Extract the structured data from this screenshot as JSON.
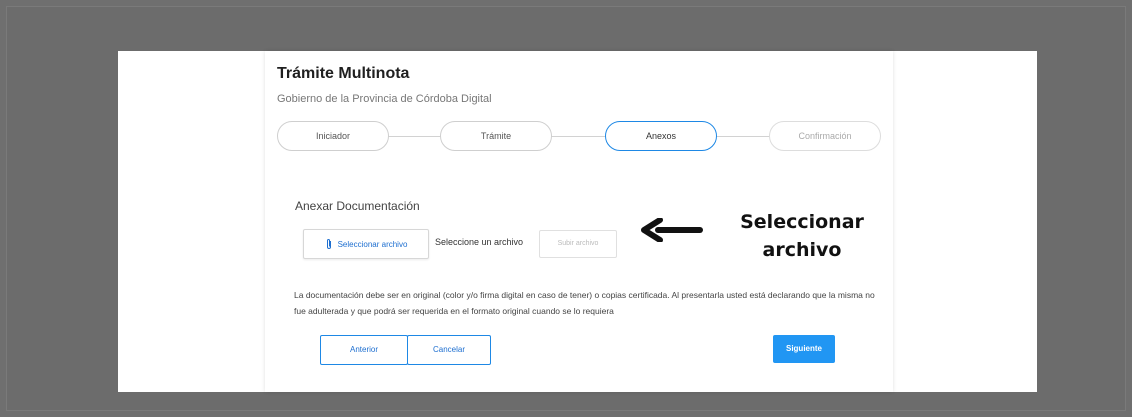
{
  "header": {
    "title": "Trámite Multinota",
    "subtitle": "Gobierno de la Provincia de Córdoba Digital"
  },
  "stepper": {
    "steps": [
      {
        "label": "Iniciador",
        "state": "done"
      },
      {
        "label": "Trámite",
        "state": "done"
      },
      {
        "label": "Anexos",
        "state": "active"
      },
      {
        "label": "Confirmación",
        "state": "pending"
      }
    ],
    "active_color": "#1e88e5"
  },
  "attachments": {
    "section_title": "Anexar Documentación",
    "select_button_label": "Seleccionar archivo",
    "select_button_icon": "paperclip-icon",
    "file_status": "Seleccione un archivo",
    "upload_button_label": "Subir archivo"
  },
  "notice": {
    "text": "La documentación debe ser en original (color y/o firma digital en caso de tener) o copias certificada. Al presentarla usted está declarando que la misma no fue adulterada y que podrá ser requerida en el formato original cuando se lo requiera"
  },
  "actions": {
    "previous_label": "Anterior",
    "cancel_label": "Cancelar",
    "next_label": "Siguiente",
    "primary_color": "#2196f3"
  },
  "annotation": {
    "line1": "Seleccionar",
    "line2": "archivo",
    "arrow_icon": "arrow-left-icon"
  }
}
